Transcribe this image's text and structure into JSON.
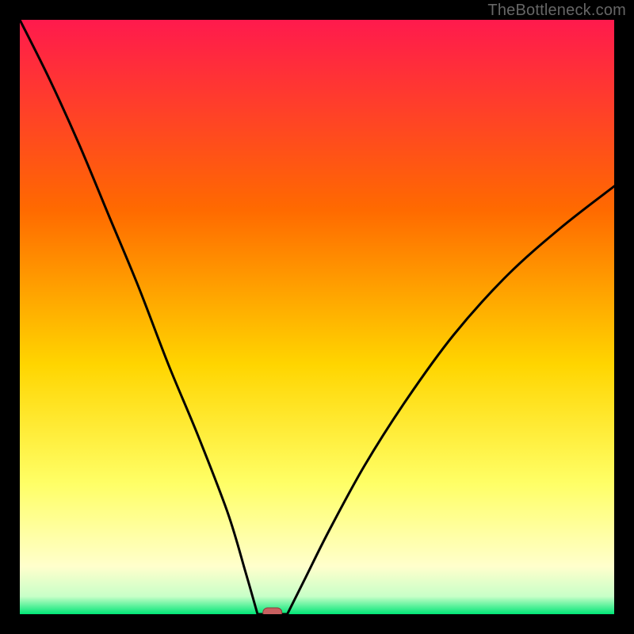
{
  "watermark": "TheBottleneck.com",
  "colors": {
    "frame": "#000000",
    "grad_top": "#ff1a4d",
    "grad_mid1": "#ff6a00",
    "grad_mid2": "#ffd500",
    "grad_mid3": "#ffff66",
    "grad_bottom_fade": "#ffffcc",
    "grad_green": "#00e676",
    "curve": "#000000",
    "marker_fill": "#c86060",
    "marker_stroke": "#8a3b3b"
  },
  "chart_data": {
    "type": "line",
    "title": "",
    "xlabel": "",
    "ylabel": "",
    "xlim": [
      0,
      100
    ],
    "ylim": [
      0,
      100
    ],
    "left_branch": {
      "x": [
        0,
        5,
        10,
        15,
        20,
        25,
        30,
        35,
        38,
        40
      ],
      "y": [
        100,
        90,
        79,
        67,
        55,
        42,
        30,
        17,
        7,
        0
      ]
    },
    "right_branch": {
      "x": [
        45,
        48,
        52,
        58,
        65,
        73,
        82,
        91,
        100
      ],
      "y": [
        0,
        6,
        14,
        25,
        36,
        47,
        57,
        65,
        72
      ]
    },
    "flat_segment": {
      "x": [
        40,
        45
      ],
      "y": [
        0,
        0
      ]
    },
    "marker": {
      "x": 42.5,
      "y": 0
    }
  }
}
